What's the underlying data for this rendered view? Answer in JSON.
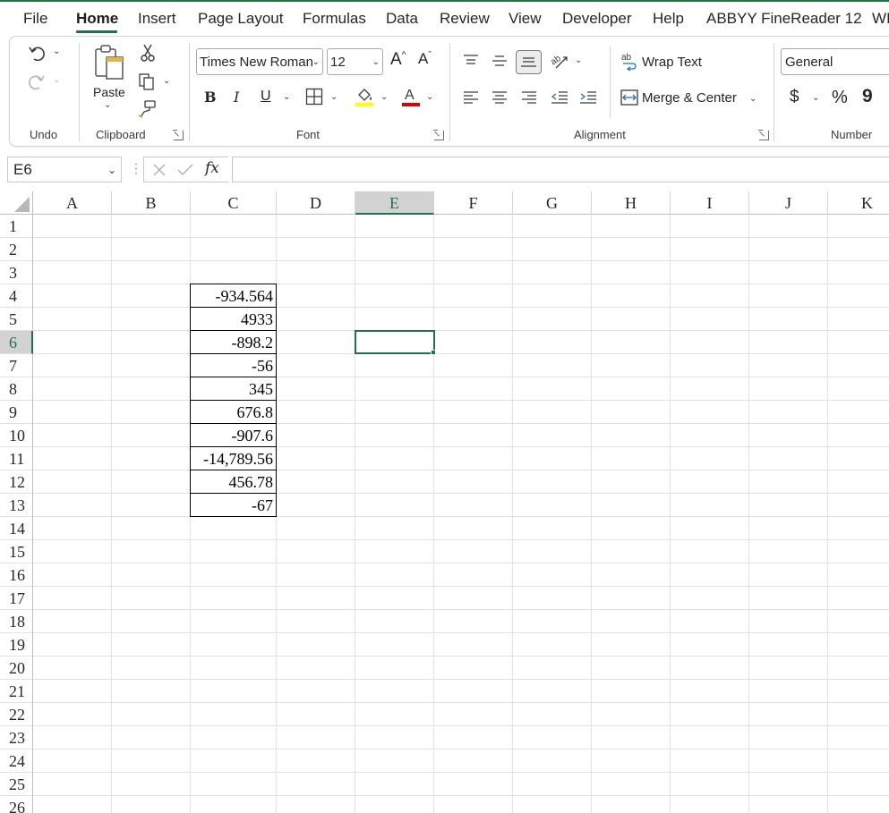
{
  "tabs": [
    "File",
    "Home",
    "Insert",
    "Page Layout",
    "Formulas",
    "Data",
    "Review",
    "View",
    "Developer",
    "Help",
    "ABBYY FineReader 12",
    "WI"
  ],
  "active_tab": "Home",
  "ribbon": {
    "groups": {
      "undo": "Undo",
      "clipboard": "Clipboard",
      "font": "Font",
      "alignment": "Alignment",
      "number": "Number"
    },
    "paste_label": "Paste",
    "font_name": "Times New Roman",
    "font_size": "12",
    "bold": "B",
    "italic": "I",
    "underline": "U",
    "wrap_text": "Wrap Text",
    "merge_center": "Merge & Center",
    "number_format": "General",
    "currency": "$",
    "percent": "%",
    "comma": "9"
  },
  "formula_bar": {
    "name_box": "E6",
    "fx": "fx",
    "formula": ""
  },
  "sheet": {
    "columns": [
      "A",
      "B",
      "C",
      "D",
      "E",
      "F",
      "G",
      "H",
      "I",
      "J",
      "K"
    ],
    "rows": [
      "1",
      "2",
      "3",
      "4",
      "5",
      "6",
      "7",
      "8",
      "9",
      "10",
      "11",
      "12",
      "13",
      "14",
      "15",
      "16",
      "17",
      "18",
      "19",
      "20",
      "21",
      "22",
      "23",
      "24",
      "25",
      "26"
    ],
    "selected_cell": "E6",
    "selected_column": "E",
    "selected_row": "6",
    "column_c_values": [
      {
        "row": "4",
        "value": "-934.564"
      },
      {
        "row": "5",
        "value": "4933"
      },
      {
        "row": "6",
        "value": "-898.2"
      },
      {
        "row": "7",
        "value": "-56"
      },
      {
        "row": "8",
        "value": "345"
      },
      {
        "row": "9",
        "value": "676.8"
      },
      {
        "row": "10",
        "value": "-907.6"
      },
      {
        "row": "11",
        "value": "-14,789.56"
      },
      {
        "row": "12",
        "value": "456.78"
      },
      {
        "row": "13",
        "value": "-67"
      }
    ]
  },
  "colors": {
    "accent": "#217346",
    "highlight_yellow": "#ffff00",
    "font_red": "#e00000"
  }
}
